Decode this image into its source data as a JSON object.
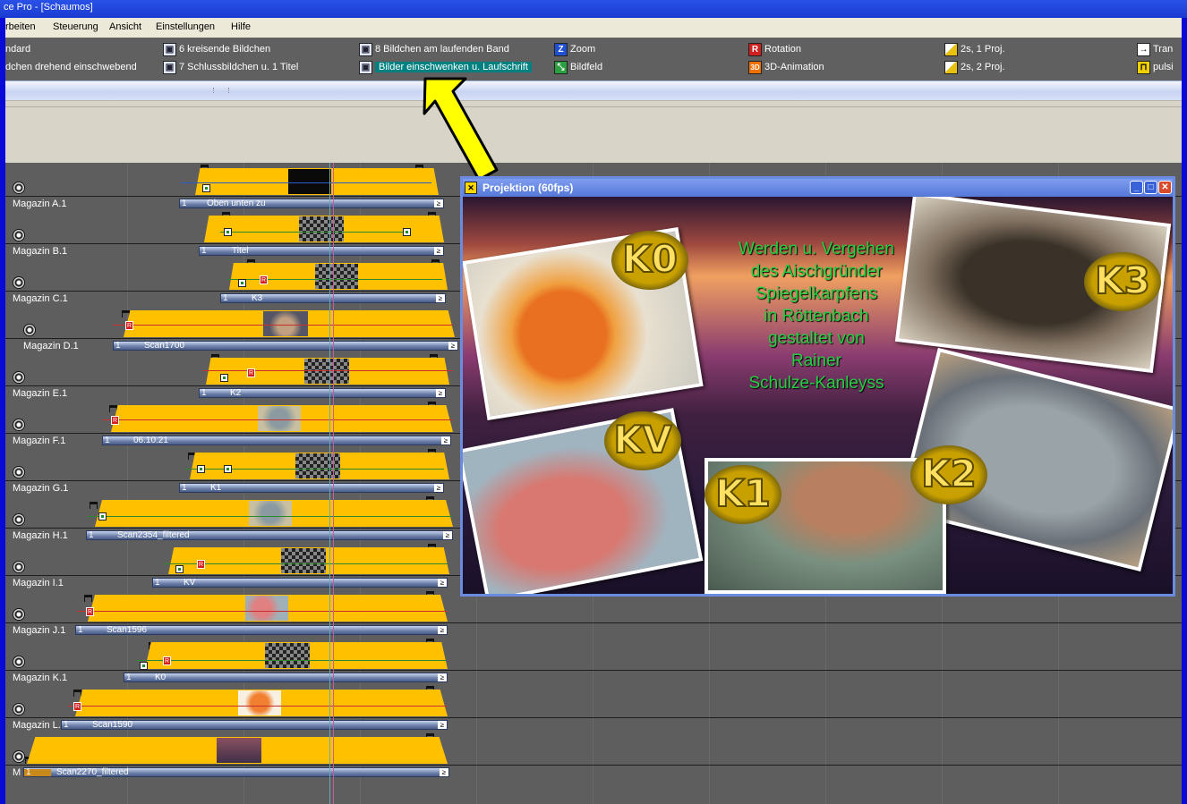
{
  "window": {
    "title": "ce Pro - [Schaumos]"
  },
  "menu": [
    "rbeiten",
    "Steuerung",
    "Ansicht",
    "Einstellungen",
    "Hilfe"
  ],
  "templates": [
    {
      "label": "ndard",
      "icon": "none"
    },
    {
      "label": "dchen drehend einschwebend",
      "icon": "none"
    },
    {
      "label": "6 kreisende Bildchen",
      "icon": "film-icon"
    },
    {
      "label": "7 Schlussbildchen u. 1 Titel",
      "icon": "film-icon"
    },
    {
      "label": "8 Bildchen am laufenden Band",
      "icon": "film-icon"
    },
    {
      "label": "Bilder einschwenken u. Laufschrift",
      "icon": "film-icon",
      "selected": true
    },
    {
      "label": "Zoom",
      "icon": "zoom-icon",
      "glyph": "Z"
    },
    {
      "label": "Bildfeld",
      "icon": "image-field-icon",
      "glyph": "⤡"
    },
    {
      "label": "Rotation",
      "icon": "rotation-icon",
      "glyph": "R"
    },
    {
      "label": "3D-Animation",
      "icon": "3d-icon",
      "glyph": "3D"
    },
    {
      "label": "2s, 1 Proj.",
      "icon": "fade-ramp-icon"
    },
    {
      "label": "2s, 2 Proj.",
      "icon": "fade-ramp-icon"
    },
    {
      "label": "Tran",
      "icon": "transition-arrow-icon",
      "glyph": "→"
    },
    {
      "label": "pulsi",
      "icon": "pulse-icon",
      "glyph": "⊓"
    }
  ],
  "tracks": [
    {
      "name": "Magazin A.1",
      "clip": "Oben unten zu",
      "one": "1",
      "end": "≥"
    },
    {
      "name": "Magazin B.1",
      "clip": "Titel",
      "one": "1",
      "end": "≥"
    },
    {
      "name": "Magazin C.1",
      "clip": "K3",
      "one": "1",
      "end": "≥"
    },
    {
      "name": "Magazin D.1",
      "clip": "Scan1700",
      "one": "1",
      "end": "≥"
    },
    {
      "name": "Magazin E.1",
      "clip": "K2",
      "one": "1",
      "end": "≥"
    },
    {
      "name": "Magazin F.1",
      "clip": "06.10.21",
      "one": "1",
      "end": "≥"
    },
    {
      "name": "Magazin G.1",
      "clip": "K1",
      "one": "1",
      "end": "≥"
    },
    {
      "name": "Magazin H.1",
      "clip": "Scan2354_filtered",
      "one": "1",
      "end": "≥"
    },
    {
      "name": "Magazin I.1",
      "clip": "KV",
      "one": "1",
      "end": "≥"
    },
    {
      "name": "Magazin J.1",
      "clip": "Scan1596",
      "one": "1",
      "end": "≥"
    },
    {
      "name": "Magazin K.1",
      "clip": "K0",
      "one": "1",
      "end": "≥"
    },
    {
      "name": "Magazin L.1",
      "clip": "Scan1590",
      "one": "1",
      "end": "≥"
    },
    {
      "name": "M",
      "clip": "Scan2270_filtered",
      "one": "1",
      "end": "≥"
    }
  ],
  "projection": {
    "title": "Projektion (60fps)",
    "text_lines": [
      "Werden u. Vergehen",
      "des Aischgründer",
      "Spiegelkarpfens",
      "in Röttenbach",
      "gestaltet von",
      "Rainer",
      "Schulze-Kanleyss"
    ],
    "badges": [
      "K0",
      "K3",
      "KV",
      "K1",
      "K2"
    ],
    "btn_min": "_",
    "btn_max": "□",
    "btn_close": "✕",
    "icon_glyph": "✕"
  },
  "colors": {
    "accent_blue": "#0a0ad8",
    "track_yellow": "#ffc000",
    "selected_teal": "#008080"
  }
}
